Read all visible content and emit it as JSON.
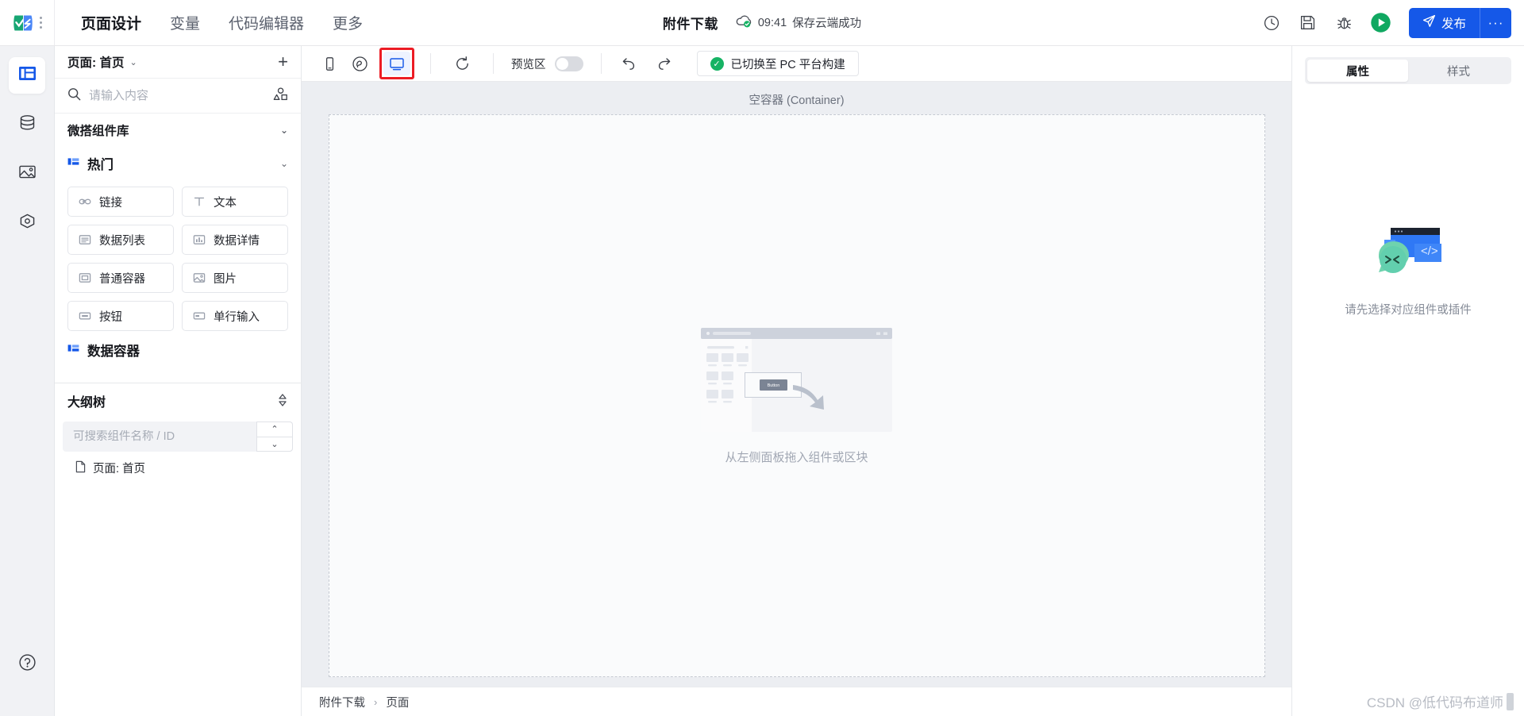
{
  "topbar": {
    "logo_icon": "weda-logo",
    "menu_icon": "vertical-dots-icon",
    "nav": [
      {
        "label": "页面设计",
        "active": true
      },
      {
        "label": "变量",
        "active": false
      },
      {
        "label": "代码编辑器",
        "active": false
      },
      {
        "label": "更多",
        "active": false
      }
    ],
    "app_title": "附件下载",
    "save_icon": "cloud-check-icon",
    "save_time": "09:41",
    "save_status": "保存云端成功",
    "actions": [
      {
        "name": "history-icon",
        "glyph": "clock"
      },
      {
        "name": "save-icon",
        "glyph": "floppy"
      },
      {
        "name": "debug-icon",
        "glyph": "bug"
      },
      {
        "name": "run-icon",
        "glyph": "play"
      }
    ],
    "publish_label": "发布",
    "publish_icon": "send-icon",
    "publish_more_label": "···"
  },
  "rail": {
    "items": [
      {
        "name": "layout-icon",
        "label": "页面",
        "active": true
      },
      {
        "name": "database-icon",
        "label": "数据",
        "active": false
      },
      {
        "name": "image-icon",
        "label": "素材",
        "active": false
      },
      {
        "name": "plugin-icon",
        "label": "插件",
        "active": false
      }
    ],
    "help": {
      "name": "help-icon",
      "label": "帮助"
    }
  },
  "left_panel": {
    "page_selector": {
      "label": "页面: 首页",
      "caret": "⌄"
    },
    "add_button": "+",
    "search": {
      "placeholder": "请输入内容",
      "value": "",
      "icon": "search-icon",
      "right_icon": "shapes-icon"
    },
    "library_title": "微搭组件库",
    "group_title": "热门",
    "components": [
      {
        "label": "链接",
        "icon": "link-icon"
      },
      {
        "label": "文本",
        "icon": "text-icon"
      },
      {
        "label": "数据列表",
        "icon": "list-icon"
      },
      {
        "label": "数据详情",
        "icon": "chart-icon"
      },
      {
        "label": "普通容器",
        "icon": "container-icon"
      },
      {
        "label": "图片",
        "icon": "picture-icon"
      },
      {
        "label": "按钮",
        "icon": "button-icon"
      },
      {
        "label": "单行输入",
        "icon": "input-icon"
      }
    ],
    "next_group_title": "数据容器",
    "outline": {
      "title": "大纲树",
      "sort_icon": "up-down-icon",
      "search_placeholder": "可搜索组件名称 / ID",
      "search_value": "",
      "prev_label": "⌃",
      "next_label": "⌄",
      "nodes": [
        {
          "label": "页面: 首页",
          "icon": "file-icon"
        }
      ]
    }
  },
  "toolbar": {
    "devices": [
      {
        "name": "mobile-icon",
        "selected": false
      },
      {
        "name": "miniprogram-icon",
        "selected": false
      },
      {
        "name": "pc-icon",
        "selected": true,
        "highlighted": true
      }
    ],
    "refresh_icon": "refresh-icon",
    "preview_label": "预览区",
    "preview_on": false,
    "undo_icon": "undo-icon",
    "redo_icon": "redo-icon",
    "status_text": "已切换至 PC 平台构建",
    "status_icon": "check-circle-icon"
  },
  "canvas": {
    "title": "空容器 (Container)",
    "empty_text": "从左侧面板拖入组件或区块",
    "illustration_button_label": "Button"
  },
  "breadcrumb": {
    "items": [
      "附件下载",
      "页面"
    ],
    "separator": "›"
  },
  "right_panel": {
    "tabs": [
      {
        "label": "属性",
        "active": true
      },
      {
        "label": "样式",
        "active": false
      }
    ],
    "empty_text": "请先选择对应组件或插件",
    "empty_illustration": "code-window-chat-icon"
  },
  "watermark": {
    "text": "CSDN @低代码布道师"
  },
  "colors": {
    "accent": "#1558e8",
    "success": "#16b364",
    "highlight": "#ec1c24",
    "panel_bg": "#f1f2f5",
    "canvas_bg": "#eceef2"
  }
}
